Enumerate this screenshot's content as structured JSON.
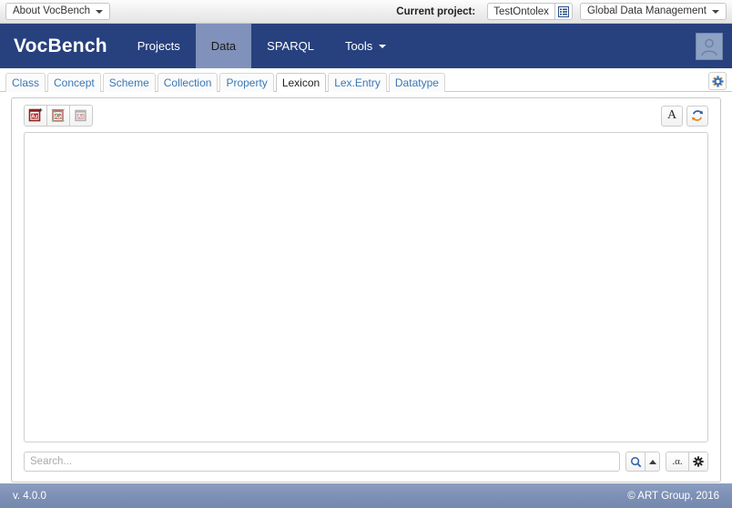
{
  "topbar": {
    "about_button": "About VocBench",
    "current_project_label": "Current project:",
    "current_project_value": "TestOntolex",
    "project_list_icon": "list-icon",
    "role_selector": "Global Data Management"
  },
  "navbar": {
    "brand": "VocBench",
    "items": [
      {
        "label": "Projects",
        "active": false,
        "has_caret": false
      },
      {
        "label": "Data",
        "active": true,
        "has_caret": false
      },
      {
        "label": "SPARQL",
        "active": false,
        "has_caret": false
      },
      {
        "label": "Tools",
        "active": false,
        "has_caret": true
      }
    ],
    "avatar_icon": "user-avatar-icon"
  },
  "tabstrip": {
    "tabs": [
      {
        "label": "Class",
        "active": false
      },
      {
        "label": "Concept",
        "active": false
      },
      {
        "label": "Scheme",
        "active": false
      },
      {
        "label": "Collection",
        "active": false
      },
      {
        "label": "Property",
        "active": false
      },
      {
        "label": "Lexicon",
        "active": true
      },
      {
        "label": "Lex.Entry",
        "active": false
      },
      {
        "label": "Datatype",
        "active": false
      }
    ],
    "settings_icon": "gear-icon"
  },
  "panel": {
    "toolbar": {
      "create_lexicon_icon": "create-lexicon-icon",
      "delete_lexicon_icon": "delete-lexicon-icon",
      "edit-lexicon_icon": "lexicon-properties-icon",
      "rendering_button_label": "A",
      "refresh_icon": "refresh-icon"
    },
    "tree": {
      "items": []
    },
    "search": {
      "placeholder": "Search...",
      "value": "",
      "search_icon": "magnifier-icon",
      "expand_icon": "caret-up-icon",
      "lang_button_label": ".α.",
      "settings_icon": "gear-icon"
    }
  },
  "footer": {
    "version": "v. 4.0.0",
    "copyright": "© ART Group, 2016"
  },
  "colors": {
    "navbar_bg": "#27417e",
    "navbar_active": "#8092bb",
    "tab_link": "#3a78b5",
    "footer_bg": "#7d90b5"
  }
}
